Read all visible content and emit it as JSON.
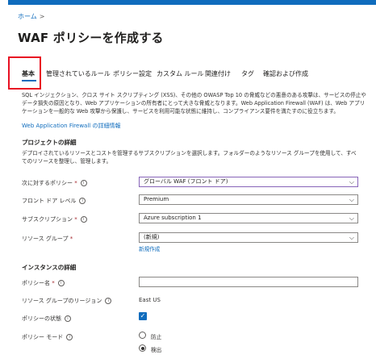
{
  "breadcrumb": {
    "home": "ホーム",
    "separator": ">"
  },
  "page": {
    "title": "WAF ポリシーを作成する",
    "more": "···"
  },
  "tabs": [
    {
      "label": "基本",
      "active": true
    },
    {
      "label": "管理されているルール"
    },
    {
      "label": "ポリシー設定"
    },
    {
      "label": "カスタム ルール"
    },
    {
      "label": "関連付け"
    },
    {
      "label": "タグ"
    },
    {
      "label": "確認および作成"
    }
  ],
  "description": "SQL インジェクション、クロス サイト スクリプティング (XSS)、その他の OWASP Top 10 の脅威などの悪意のある攻撃は、サービスの停止やデータ損失の原因となり、Web アプリケーションの所有者にとって大きな脅威となります。Web Application Firewall (WAF) は、Web アプリケーションを一般的な Web 攻撃から保護し、サービスを利用可能な状態に維持し、コンプライアンス要件を満たすのに役立ちます。",
  "learn_more_link": "Web Application Firewall の詳細情報",
  "project": {
    "heading": "プロジェクトの詳細",
    "description": "デプロイされているリソースとコストを管理するサブスクリプションを選択します。フォルダーのようなリソース グループを使用して、すべてのリソースを整理し、管理します。"
  },
  "fields": {
    "policy_for": {
      "label": "次に対するポリシー",
      "required": "*",
      "value": "グローバル WAF (フロント ドア)"
    },
    "frontdoor_tier": {
      "label": "フロント ドア レベル",
      "value": "Premium"
    },
    "subscription": {
      "label": "サブスクリプション",
      "required": "*",
      "value": "Azure subscription 1"
    },
    "resource_group": {
      "label": "リソース グループ",
      "required": "*",
      "value": "(新規)",
      "new_link": "新規作成"
    }
  },
  "instance": {
    "heading": "インスタンスの詳細",
    "policy_name": {
      "label": "ポリシー名",
      "required": "*",
      "value": ""
    },
    "region": {
      "label": "リソース グループのリージョン",
      "value": "East US"
    },
    "enabled": {
      "label": "ポリシーの状態",
      "checked": true
    },
    "mode": {
      "label": "ポリシー モード",
      "options": [
        {
          "label": "防止",
          "selected": false
        },
        {
          "label": "検出",
          "selected": true
        }
      ]
    }
  },
  "icons": {
    "info": "info-icon",
    "chevron": "chevron-down-icon",
    "check": "checkmark-icon"
  },
  "colors": {
    "accent": "#0f6cbd",
    "highlight_box": "#e81123",
    "focus_border": "#8764b8"
  }
}
